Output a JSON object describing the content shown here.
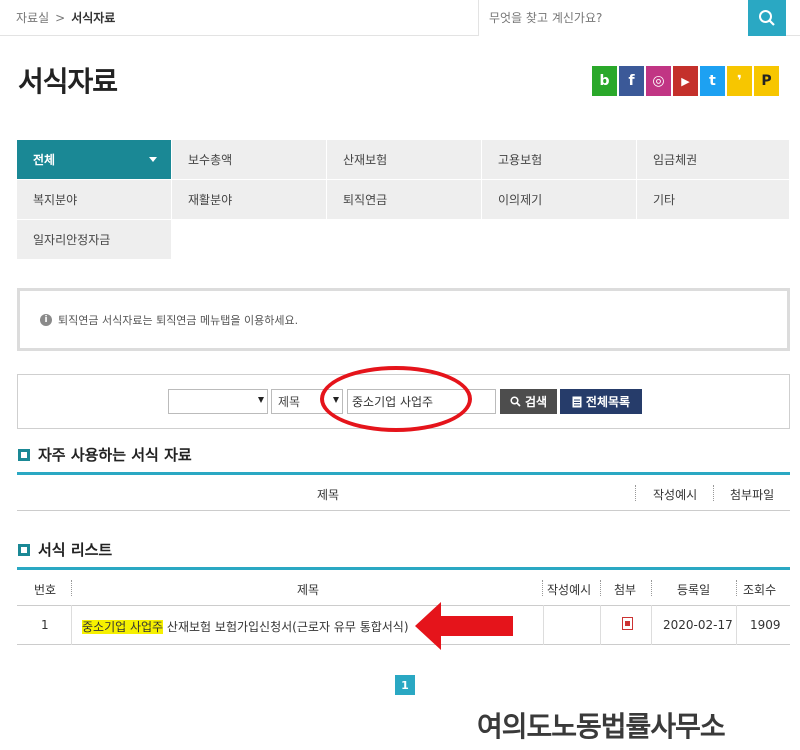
{
  "breadcrumb": {
    "parent": "자료실",
    "separator": ">",
    "current": "서식자료"
  },
  "search": {
    "placeholder": "무엇을 찾고 계신가요?"
  },
  "page_title": "서식자료",
  "social": [
    {
      "label": "b",
      "color": "#2aa82a",
      "icon": "blog-icon"
    },
    {
      "label": "f",
      "color": "#3b5998",
      "icon": "facebook-icon"
    },
    {
      "label": "◎",
      "color": "#c13584",
      "icon": "instagram-icon"
    },
    {
      "label": "▶",
      "color": "#c4302b",
      "icon": "youtube-icon"
    },
    {
      "label": "t",
      "color": "#1da1f2",
      "icon": "twitter-icon"
    },
    {
      "label": "❜",
      "color": "#f7c600",
      "icon": "kakaostory-icon"
    },
    {
      "label": "P",
      "color": "#f7c600",
      "icon": "post-icon"
    }
  ],
  "categories": [
    "전체",
    "보수총액",
    "산재보험",
    "고용보험",
    "임금체권",
    "복지분야",
    "재활분야",
    "퇴직연금",
    "이의제기",
    "기타",
    "일자리안정자금"
  ],
  "notice": "퇴직연금 서식자료는 퇴직연금 메뉴탭을 이용하세요.",
  "search_form": {
    "select1": "",
    "select2": "제목",
    "keyword": "중소기업 사업주",
    "search_button": "검색",
    "list_button": "전체목록"
  },
  "frequent": {
    "title": "자주 사용하는 서식 자료",
    "headers": {
      "title": "제목",
      "example": "작성예시",
      "attach": "첨부파일"
    }
  },
  "list": {
    "title": "서식 리스트",
    "headers": {
      "no": "번호",
      "title": "제목",
      "example": "작성예시",
      "attach": "첨부",
      "date": "등록일",
      "views": "조회수"
    },
    "rows": [
      {
        "no": "1",
        "title_highlight": "중소기업 사업주",
        "title_rest": " 산재보험 보험가입신청서(근로자 유무 통합서식)",
        "date": "2020-02-17",
        "views": "1909"
      }
    ]
  },
  "pagination": {
    "current": "1"
  },
  "watermark": "여의도노동법률사무소",
  "colors": {
    "accent": "#2aa8c3",
    "active_tab": "#1a8895",
    "highlight": "#f6f000",
    "annotation": "#e5141b"
  }
}
